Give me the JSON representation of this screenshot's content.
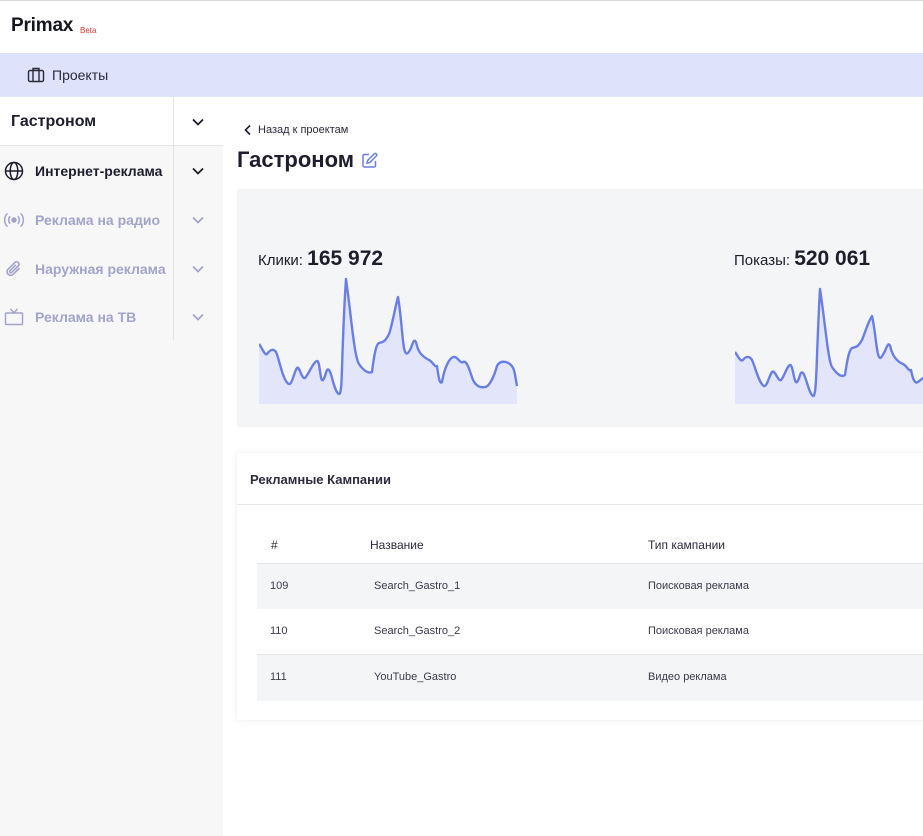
{
  "app": {
    "logo": "Primax",
    "badge": "Beta"
  },
  "projects_bar": {
    "label": "Проекты",
    "icon": "briefcase-icon"
  },
  "sidebar": {
    "project_title": "Гастроном",
    "items": [
      {
        "label": "Интернет-реклама",
        "icon": "globe-icon",
        "state": "active"
      },
      {
        "label": "Реклама на радио",
        "icon": "radio-broadcast-icon",
        "state": "muted"
      },
      {
        "label": "Наружная реклама",
        "icon": "paperclip-icon",
        "state": "muted"
      },
      {
        "label": "Реклама на ТВ",
        "icon": "tv-icon",
        "state": "muted"
      }
    ]
  },
  "main": {
    "back_label": "Назад к проектам",
    "title": "Гастроном"
  },
  "stats": {
    "clicks": {
      "label": "Клики:",
      "value": "165 972"
    },
    "impressions": {
      "label": "Показы:",
      "value": "520 061"
    }
  },
  "campaigns": {
    "title": "Рекламные Кампании",
    "columns": [
      "#",
      "Название",
      "Тип кампании"
    ],
    "rows": [
      {
        "id": "109",
        "name": "Search_Gastro_1",
        "type": "Поисковая реклама"
      },
      {
        "id": "110",
        "name": "Search_Gastro_2",
        "type": "Поисковая реклама"
      },
      {
        "id": "111",
        "name": "YouTube_Gastro",
        "type": "Видео реклама"
      }
    ]
  },
  "colors": {
    "accent": "#6a7fe6",
    "fill": "#e3e6fb",
    "projects_bar": "#dfe2fb",
    "badge": "#d93a3a"
  }
}
